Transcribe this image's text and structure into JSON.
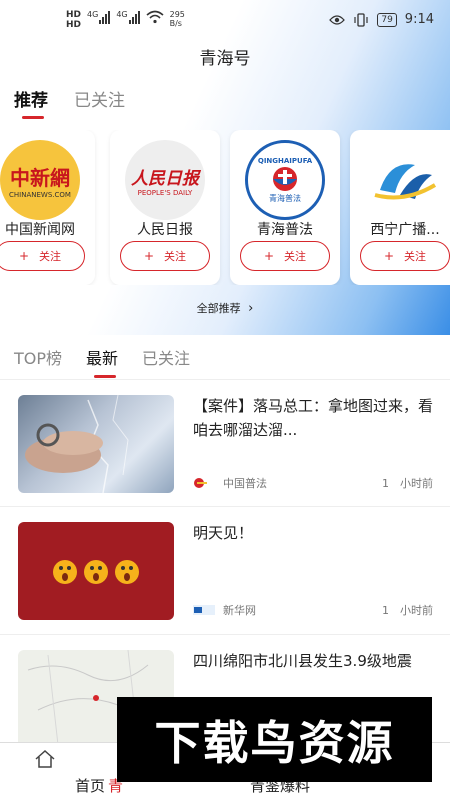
{
  "status_bar": {
    "hd1": "HD",
    "hd2": "HD",
    "net1": "4G",
    "net2": "4G",
    "speed_value": "295",
    "speed_unit": "B/s",
    "battery": "79",
    "time": "9:14"
  },
  "page_title": "青海号",
  "top_tabs": [
    {
      "label": "推荐",
      "active": true
    },
    {
      "label": "已关注",
      "active": false
    }
  ],
  "accounts": [
    {
      "name": "中国新闻网",
      "logo_text": "中新網",
      "logo_sub": "CHINANEWS.COM",
      "follow": "关注"
    },
    {
      "name": "人民日报",
      "logo_text": "人民日报",
      "logo_sub": "PEOPLE'S DAILY",
      "follow": "关注"
    },
    {
      "name": "青海普法",
      "logo_text": "QINGHAIPUFA",
      "logo_sub": "青海普法",
      "follow": "关注"
    },
    {
      "name": "西宁广播...",
      "logo_text": "",
      "logo_sub": "",
      "follow": "关注"
    }
  ],
  "all_recommend": "全部推荐",
  "section_tabs": [
    {
      "label": "TOP榜",
      "active": false
    },
    {
      "label": "最新",
      "active": true
    },
    {
      "label": "已关注",
      "active": false
    }
  ],
  "news": [
    {
      "title": "【案件】落马总工：拿地图过来，看咱去哪溜达溜...",
      "source": "中国普法",
      "time": "1　小时前"
    },
    {
      "title": "明天见！",
      "source": "新华网",
      "time": "1　小时前"
    },
    {
      "title": "四川绵阳市北川县发生3.9级地震",
      "source": "",
      "time": ""
    }
  ],
  "bottom_nav": [
    {
      "label": "首页",
      "icon": "home-icon"
    },
    {
      "label": "青",
      "icon": ""
    },
    {
      "label": "青鉴爆料",
      "icon": ""
    }
  ],
  "watermark": "下载鸟资源",
  "colors": {
    "accent": "#d6262b",
    "blue": "#3a8ee6"
  }
}
